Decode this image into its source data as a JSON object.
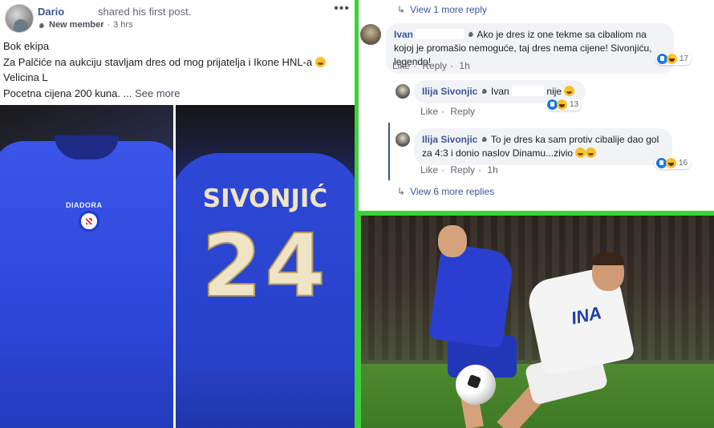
{
  "post": {
    "author": "Dario",
    "action": "shared his first post.",
    "member_badge": "New member",
    "separator": "·",
    "time": "3 hrs",
    "menu_icon": "more-dots-icon",
    "lines": [
      "Bok ekipa",
      "Za Palčiće na aukciju stavljam dres od mog prijatelja i Ikone HNL-a",
      "Velicina L",
      "Pocetna cijena 200 kuna. ..."
    ],
    "see_more": "See more"
  },
  "photos": {
    "left_brand": "DIADORA",
    "jersey_name": "SIVONJIĆ",
    "jersey_number": "24"
  },
  "comments": {
    "view_one": "View 1 more reply",
    "ivan": {
      "name": "Ivan",
      "text": "Ako je dres iz one tekme sa cibaliom na kojoj je promašio nemoguće, taj dres nema cijene! Sivonjiću, legendo!",
      "like": "Like",
      "reply": "Reply",
      "time": "1h",
      "reactions": "17"
    },
    "ilija1": {
      "name": "Ilija Sivonjic",
      "mention": "Ivan",
      "text": "nije",
      "like": "Like",
      "reply": "Reply",
      "reactions": "13"
    },
    "ilija2": {
      "name": "Ilija Sivonjic",
      "text": "To je dres ka sam protiv cibalije dao gol za 4:3 i donio naslov Dinamu...zivio",
      "like": "Like",
      "reply": "Reply",
      "time": "1h",
      "reactions": "16"
    },
    "view_six": "View 6 more replies"
  },
  "match_photo": {
    "shirt_sponsor": "INA"
  },
  "colors": {
    "border_green": "#3ed13a",
    "link_blue": "#385898",
    "bubble": "#f2f3f5"
  }
}
